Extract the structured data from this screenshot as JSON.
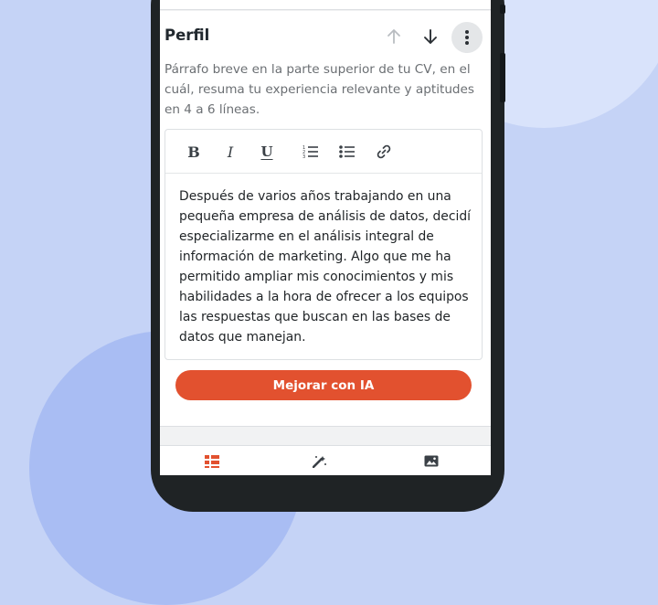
{
  "section": {
    "title": "Perfil",
    "description": "Párrafo breve en la parte superior de tu CV, en el cuál, resuma tu experiencia relevante y aptitudes en 4 a 6 líneas."
  },
  "header_actions": {
    "move_up_icon": "arrow-up-icon",
    "move_down_icon": "arrow-down-icon",
    "more_icon": "more-vertical-icon"
  },
  "toolbar": {
    "bold_glyph": "B",
    "italic_glyph": "I",
    "underline_glyph": "U",
    "ordered_list_icon": "ordered-list-icon",
    "bullet_list_icon": "bullet-list-icon",
    "link_icon": "link-icon"
  },
  "editor": {
    "content": "Después de varios años trabajando en una pequeña empresa de análisis de datos, decidí especializarme en el análisis integral de información de marketing. Algo que me ha permitido ampliar mis conocimientos y mis habilidades a la hora de ofrecer a los equipos las respuestas que buscan en las bases de datos que manejan."
  },
  "ai_button": {
    "label": "Mejorar con IA"
  },
  "bottom_nav": [
    {
      "icon": "sections-icon",
      "active": true
    },
    {
      "icon": "design-icon",
      "active": false
    },
    {
      "icon": "image-icon",
      "active": false
    }
  ],
  "colors": {
    "background": "#c5d3f6",
    "accent": "#e2512f",
    "phone_frame": "#1f2325",
    "title_text": "#22292f",
    "muted_text": "#6b6f73"
  }
}
